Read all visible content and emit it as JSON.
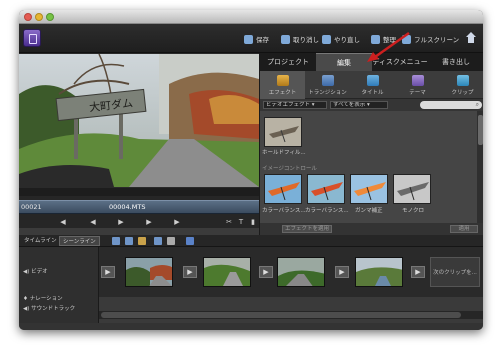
{
  "menubar": {
    "save": "保存",
    "undo": "取り消し",
    "redo": "やり直し",
    "organize": "整理",
    "fullscreen": "フルスクリーン"
  },
  "monitor": {
    "timecode": "00021",
    "clip_name": "00004.MTS",
    "sign_text": "大町ダム"
  },
  "panel": {
    "tabs": [
      "プロジェクト",
      "編集",
      "ディスクメニュー",
      "書き出し"
    ],
    "subtabs": [
      "エフェクト",
      "トランジション",
      "タイトル",
      "テーマ",
      "クリップ"
    ],
    "filter_category": "ビデオエフェクト",
    "filter_show": "すべてを表示",
    "group_top": "",
    "first_effect": "ホールドフィル...",
    "group_image": "イメージコントロール",
    "image_effects": [
      "カラーバランス...",
      "カラーバランス...",
      "ガンマ補正",
      "モノクロ"
    ],
    "apply_button": "エフェクトを適用",
    "apply_button2": "適用"
  },
  "timeline": {
    "tab_timeline": "タイムライン",
    "tab_sceneline": "シーンライン",
    "track_video": "ビデオ",
    "track_narration": "ナレーション",
    "track_soundtrack": "サウンドトラック",
    "next_clip": "次のクリップを..."
  },
  "colors": {
    "accent": "#4a2d8e",
    "callout": "#cc1f1f"
  }
}
